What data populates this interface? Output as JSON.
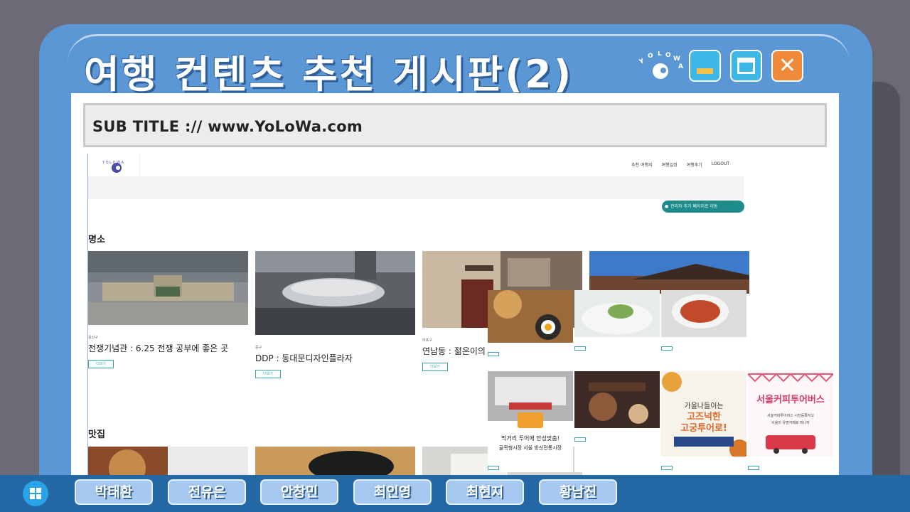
{
  "window": {
    "title": "여행 컨텐츠 추천 게시판(2)",
    "brand": "YOLOWA",
    "min_icon": "minimize-icon",
    "max_icon": "maximize-icon",
    "close_icon": "close-icon",
    "close_glyph": "✕"
  },
  "subtitle": "SUB TITLE :// www.YoLoWa.com",
  "site": {
    "nav": [
      "추천 여행지",
      "여행일정",
      "여행후기",
      "LOGOUT"
    ],
    "admin_button": "관리자 추가 페이지로 이동",
    "section_places": "명소",
    "section_food": "맛집",
    "places": [
      {
        "loc": "용산구",
        "name": "전쟁기념관 : 6.25 전쟁 공부에 좋은 곳",
        "more": "더보기"
      },
      {
        "loc": "중구",
        "name": "DDP : 동대문디자인플라자",
        "more": "더보기"
      },
      {
        "loc": "마포구",
        "name": "연남동 : 젊은이의",
        "more": "더보기"
      },
      {
        "loc": "",
        "name": "",
        "more": ""
      }
    ]
  },
  "overlay": {
    "market_line1": "먹거리 투어에 안성맞춤!",
    "market_line2": "골목형시장 서울 방신전통시장",
    "banner_autumn": "가을나들이는",
    "banner_autumn2": "고즈넉한",
    "banner_autumn3": "고궁투어로!",
    "banner_coffee": "서울커피투어버스",
    "coffee_sub1": "서울커피투어버스 시전등록하고",
    "coffee_sub2": "서울의 유명카페로 떠나자"
  },
  "taskbar": {
    "start_icon": "windows-start-icon",
    "buttons": [
      "박태환",
      "전유은",
      "안창민",
      "최인영",
      "최현지",
      "황남진"
    ]
  },
  "colors": {
    "window": "#5b97d5",
    "taskbar": "#2368a5",
    "accent": "#1e8a8a"
  }
}
